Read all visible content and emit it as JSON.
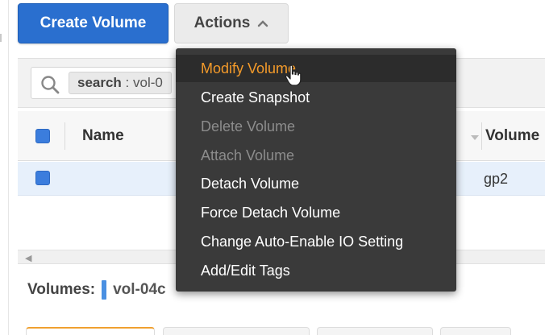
{
  "toolbar": {
    "create_label": "Create Volume",
    "actions_label": "Actions",
    "accent": "#2a6fcf"
  },
  "search": {
    "token_key": "search",
    "token_value": "vol-0"
  },
  "table": {
    "columns": [
      "Name",
      "Volume"
    ],
    "rows": [
      {
        "name": "",
        "volume_type": "gp2",
        "selected": true
      }
    ]
  },
  "details": {
    "label": "Volumes:",
    "volume_id": "vol-04c"
  },
  "actions_menu": {
    "items": [
      {
        "label": "Modify Volume",
        "state": "hover"
      },
      {
        "label": "Create Snapshot",
        "state": "enabled"
      },
      {
        "label": "Delete Volume",
        "state": "disabled"
      },
      {
        "label": "Attach Volume",
        "state": "disabled"
      },
      {
        "label": "Detach Volume",
        "state": "enabled"
      },
      {
        "label": "Force Detach Volume",
        "state": "enabled"
      },
      {
        "label": "Change Auto-Enable IO Setting",
        "state": "enabled"
      },
      {
        "label": "Add/Edit Tags",
        "state": "enabled"
      }
    ],
    "hover_color": "#f39a2a"
  },
  "icons": {
    "search": "search-icon",
    "actions_caret": "chevron-up-icon",
    "pointer": "hand-pointer-icon"
  }
}
